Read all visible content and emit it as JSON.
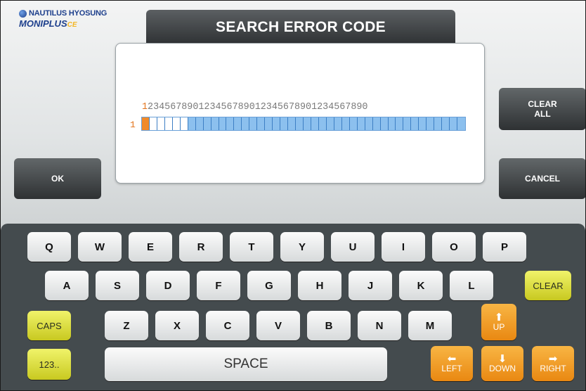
{
  "brand": {
    "line1": "NAUTILUS HYOSUNG",
    "line2": "MONIPLUS",
    "line2_suffix": "CE"
  },
  "title": "SEARCH ERROR CODE",
  "entry": {
    "ruler_first": "1",
    "ruler_rest": "234567890123456789012345678901234567890",
    "row_label": "1"
  },
  "buttons": {
    "clear_all_1": "CLEAR",
    "clear_all_2": "ALL",
    "ok": "OK",
    "cancel": "CANCEL"
  },
  "keys": {
    "row1": [
      "Q",
      "W",
      "E",
      "R",
      "T",
      "Y",
      "U",
      "I",
      "O",
      "P"
    ],
    "row2": [
      "A",
      "S",
      "D",
      "F",
      "G",
      "H",
      "J",
      "K",
      "L"
    ],
    "row3": [
      "Z",
      "X",
      "C",
      "V",
      "B",
      "N",
      "M"
    ],
    "clear": "CLEAR",
    "caps": "CAPS",
    "num": "123..",
    "space": "SPACE",
    "up": "UP",
    "left": "LEFT",
    "down": "DOWN",
    "right": "RIGHT"
  },
  "colors": {
    "accent_orange": "#f08a2a",
    "field_blue": "#8cc0ee",
    "yellow_key": "#e6e84a"
  }
}
